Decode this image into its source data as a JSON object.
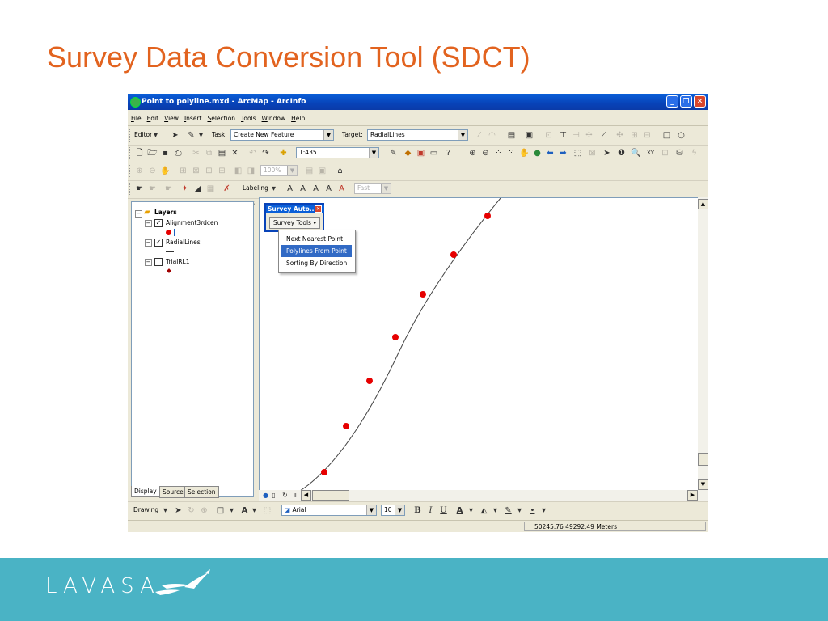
{
  "slide": {
    "title": "Survey Data Conversion Tool (SDCT)",
    "logo_text": "LAVASA",
    "colors": {
      "title": "#e2631f",
      "footer": "#4ab3c5"
    }
  },
  "window": {
    "title": "Point to polyline.mxd - ArcMap - ArcInfo",
    "menus": [
      "File",
      "Edit",
      "View",
      "Insert",
      "Selection",
      "Tools",
      "Window",
      "Help"
    ]
  },
  "editor_toolbar": {
    "editor_label": "Editor",
    "task_label": "Task:",
    "task_value": "Create New Feature",
    "target_label": "Target:",
    "target_value": "RadialLines"
  },
  "standard_toolbar": {
    "scale_value": "1:435"
  },
  "layout_toolbar": {
    "zoom_value": "100%"
  },
  "labeling_toolbar": {
    "labeling_label": "Labeling",
    "speed_value": "Fast"
  },
  "toc": {
    "root": "Layers",
    "layers": [
      {
        "name": "Alignment3rdcen",
        "checked": true
      },
      {
        "name": "RadialLines",
        "checked": true
      },
      {
        "name": "TrialRL1",
        "checked": false
      }
    ],
    "tabs": [
      "Display",
      "Source",
      "Selection"
    ]
  },
  "survey_window": {
    "title": "Survey Auto...",
    "tools_label": "Survey Tools",
    "menu_items": [
      "Next Nearest Point",
      "Polylines From Point",
      "Sorting By Direction"
    ],
    "selected_item": "Polylines From Point"
  },
  "drawing_toolbar": {
    "drawing_label": "Drawing",
    "font_value": "Arial",
    "size_value": "10"
  },
  "status_bar": {
    "coordinates": "50245.76  49292.49 Meters"
  }
}
